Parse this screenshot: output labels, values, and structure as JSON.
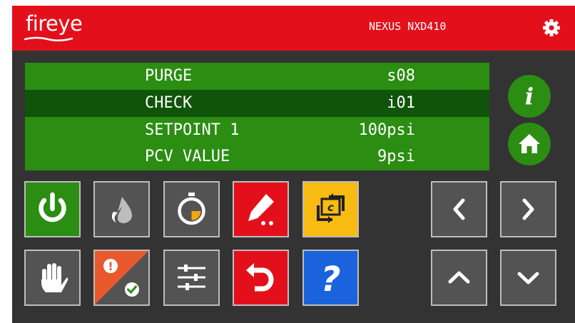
{
  "header": {
    "logo_text": "fireye",
    "model": "NEXUS NXD410",
    "settings_icon": "gear-icon"
  },
  "colors": {
    "red": "#e3101b",
    "lcd_green": "#2b8d12",
    "lcd_selected": "#0f5409",
    "button_green": "#2b8d12",
    "gray": "#535353",
    "yellow": "#f7bb12",
    "blue": "#1a63dd",
    "orange": "#e8592d"
  },
  "lcd": {
    "rows": [
      {
        "label": "PURGE",
        "value": "s08",
        "selected": false
      },
      {
        "label": "CHECK",
        "value": "i01",
        "selected": true
      },
      {
        "label": "SETPOINT 1",
        "value": "100psi",
        "selected": false
      },
      {
        "label": "PCV VALUE",
        "value": "9psi",
        "selected": false
      }
    ]
  },
  "side_buttons": [
    {
      "icon": "info-icon",
      "glyph": "i"
    },
    {
      "icon": "home-icon"
    }
  ],
  "function_buttons": {
    "row1": [
      {
        "icon": "power-icon",
        "color": "green"
      },
      {
        "icon": "flame-icon",
        "color": "gray"
      },
      {
        "icon": "stopwatch-icon",
        "color": "gray"
      },
      {
        "icon": "edit-pencil-icon",
        "color": "red"
      },
      {
        "icon": "cycle-c-icon",
        "color": "yellow",
        "glyph": "c"
      }
    ],
    "row2": [
      {
        "icon": "hand-stop-icon",
        "color": "gray"
      },
      {
        "icon": "alarm-acknowledge-icon",
        "color": "orange",
        "glyph": "!"
      },
      {
        "icon": "sliders-icon",
        "color": "gray"
      },
      {
        "icon": "undo-icon",
        "color": "red"
      },
      {
        "icon": "help-question-icon",
        "color": "blue",
        "glyph": "?"
      }
    ]
  },
  "nav_buttons": [
    {
      "icon": "chevron-left-icon"
    },
    {
      "icon": "chevron-right-icon"
    },
    {
      "icon": "chevron-up-icon"
    },
    {
      "icon": "chevron-down-icon"
    }
  ]
}
